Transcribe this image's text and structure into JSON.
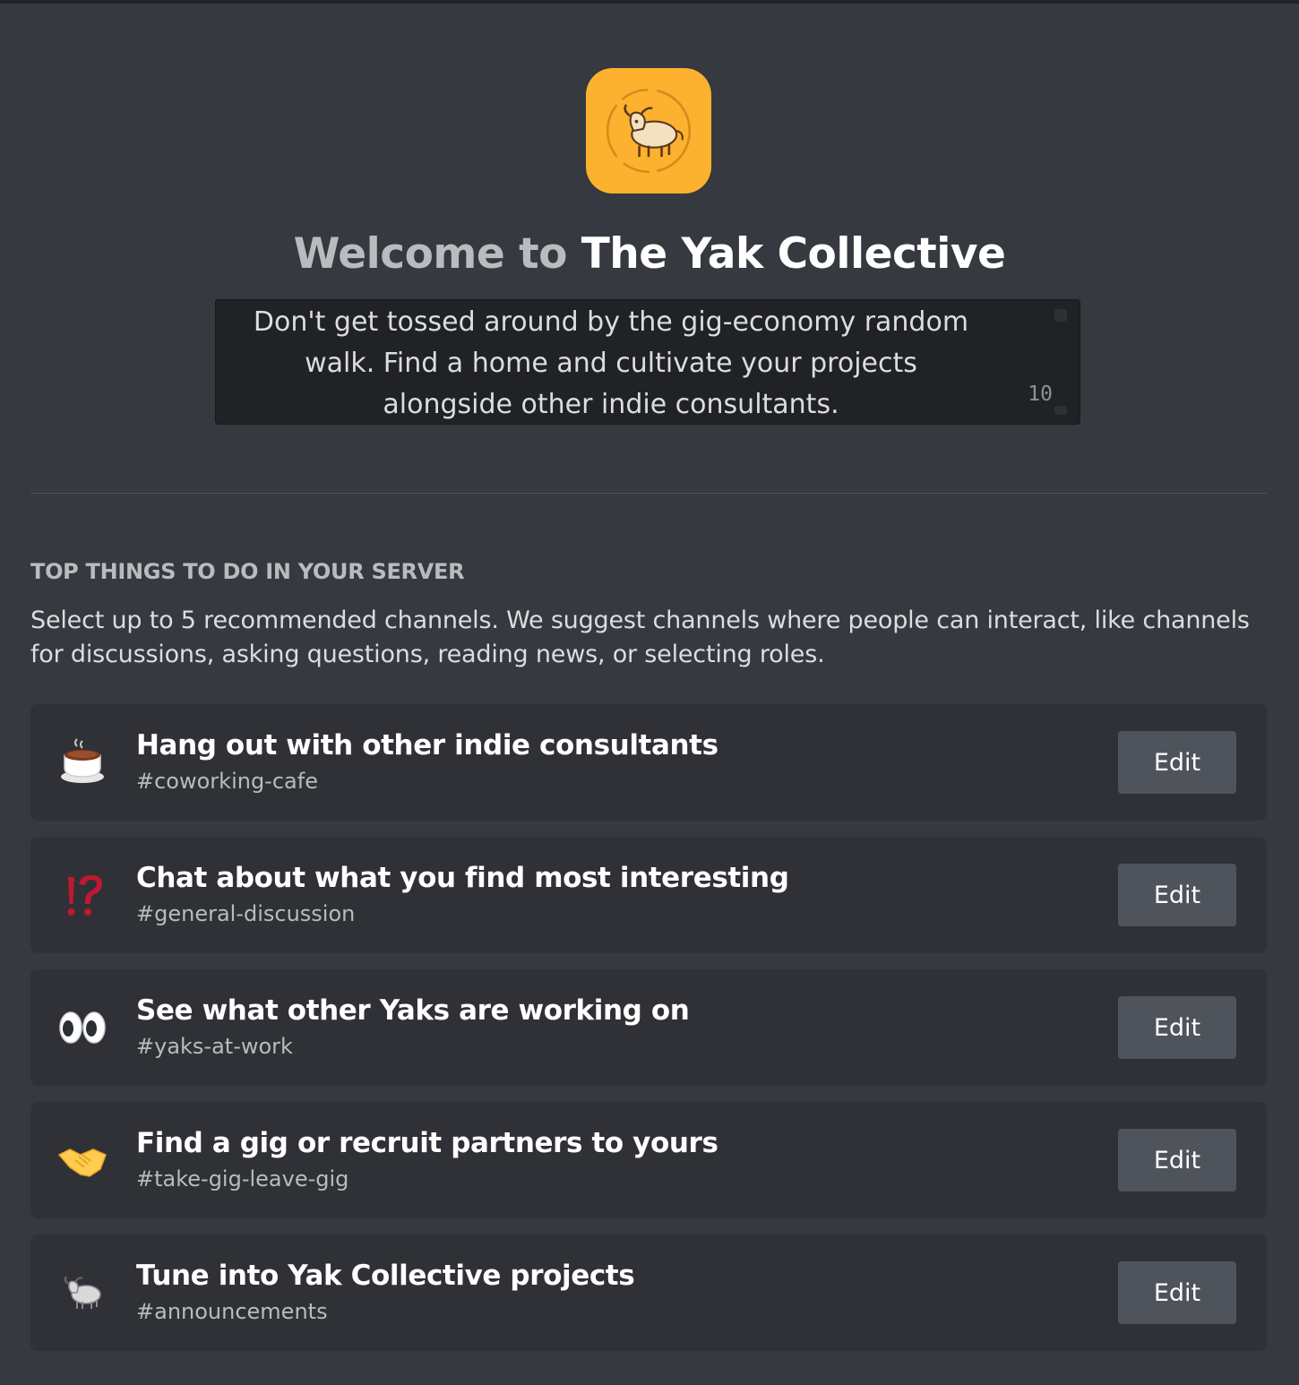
{
  "server": {
    "icon": "yak-icon",
    "accent_color": "#fcb22f",
    "welcome_prefix": "Welcome to",
    "name": "The Yak Collective",
    "description": "Don't get tossed around by the gig-economy random walk. Find a home and cultivate your projects alongside other indie consultants.",
    "char_count": "10"
  },
  "section": {
    "title": "TOP THINGS TO DO IN YOUR SERVER",
    "description": "Select up to 5 recommended channels. We suggest channels where people can interact, like channels for discussions, asking questions, reading news, or selecting roles."
  },
  "channels": [
    {
      "icon": "coffee-icon",
      "title": "Hang out with other indie consultants",
      "channel": "#coworking-cafe",
      "edit_label": "Edit"
    },
    {
      "icon": "interrobang-icon",
      "title": "Chat about what you find most interesting",
      "channel": "#general-discussion",
      "edit_label": "Edit"
    },
    {
      "icon": "eyes-icon",
      "title": "See what other Yaks are working on",
      "channel": "#yaks-at-work",
      "edit_label": "Edit"
    },
    {
      "icon": "handshake-icon",
      "title": "Find a gig or recruit partners to yours",
      "channel": "#take-gig-leave-gig",
      "edit_label": "Edit"
    },
    {
      "icon": "yak-icon",
      "title": "Tune into Yak Collective projects",
      "channel": "#announcements",
      "edit_label": "Edit"
    }
  ]
}
